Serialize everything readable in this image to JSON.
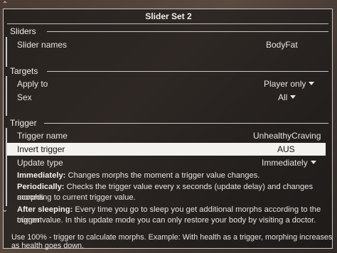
{
  "window": {
    "title": "Slider Set 2"
  },
  "sections": {
    "sliders": {
      "header": "Sliders",
      "slider_names_label": "Slider names",
      "slider_names_value": "BodyFat"
    },
    "targets": {
      "header": "Targets",
      "apply_to_label": "Apply to",
      "apply_to_value": "Player only",
      "sex_label": "Sex",
      "sex_value": "All"
    },
    "trigger": {
      "header": "Trigger",
      "trigger_name_label": "Trigger name",
      "trigger_name_value": "UnhealthyCraving",
      "invert_label": "Invert trigger",
      "invert_value": "AUS",
      "update_type_label": "Update type",
      "update_type_value": "Immediately"
    }
  },
  "descriptions": {
    "immediately_term": "Immediately:",
    "immediately_text": " Changes morphs the moment a trigger value changes.",
    "periodically_term": "Periodically:",
    "periodically_text_1": " Checks the trigger value every x seconds (update delay) and changes morphs",
    "periodically_text_2": "according to current trigger value.",
    "after_sleeping_term": "After sleeping:",
    "after_sleeping_text_1": " Every time you go to sleep you get additional morphs according to the current",
    "after_sleeping_text_2": "trigger value. In this update mode you can only restore your body by visiting a doctor."
  },
  "footer": {
    "hint": "Use 100% - trigger to calculate morphs. Example: With health as a trigger, morphing increases as health goes down."
  },
  "icons": {
    "scroll_up": "chevron-up-icon",
    "scroll_down": "chevron-down-icon",
    "dropdown": "caret-down-icon"
  }
}
